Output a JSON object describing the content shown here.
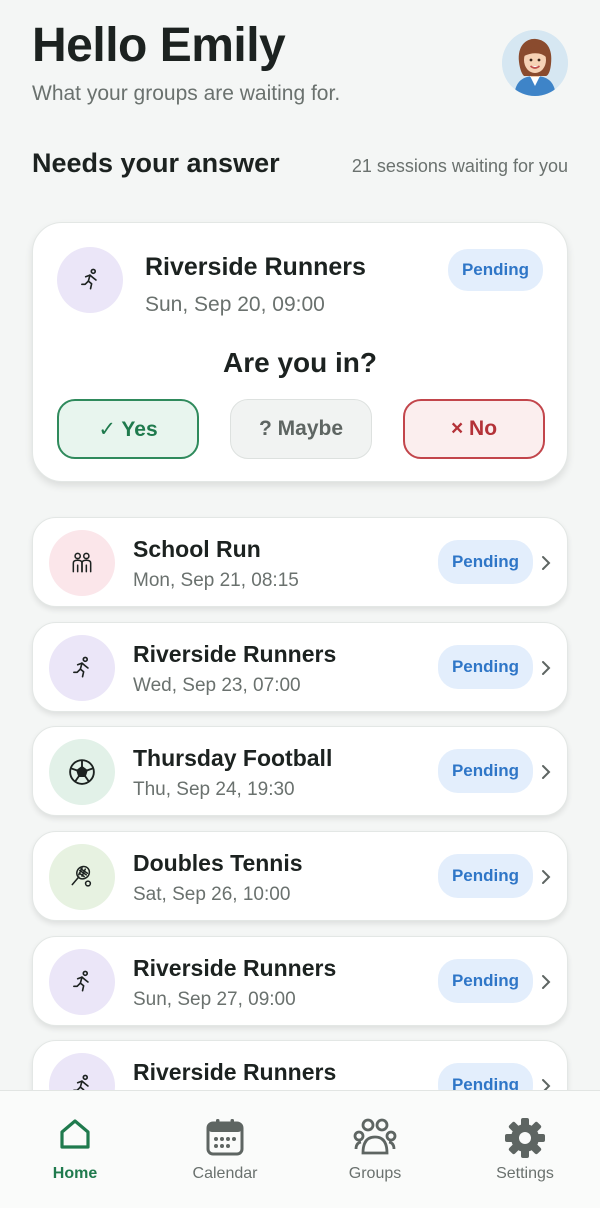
{
  "header": {
    "greeting": "Hello Emily",
    "subtitle": "What your groups are waiting for.",
    "avatar_icon": "user-avatar"
  },
  "section": {
    "title": "Needs your answer",
    "count": "21 sessions waiting for you"
  },
  "hero": {
    "title": "Riverside Runners",
    "date": "Sun, Sep 20, 09:00",
    "status": "Pending",
    "icon": "runner-icon",
    "question": "Are you in?",
    "yes_label": "✓ Yes",
    "maybe_label": "? Maybe",
    "no_label": "× No"
  },
  "sessions": [
    {
      "title": "School Run",
      "date": "Mon, Sep 21, 08:15",
      "status": "Pending",
      "icon": "people-icon"
    },
    {
      "title": "Riverside Runners",
      "date": "Wed, Sep 23, 07:00",
      "status": "Pending",
      "icon": "runner-icon"
    },
    {
      "title": "Thursday Football",
      "date": "Thu, Sep 24, 19:30",
      "status": "Pending",
      "icon": "football-icon"
    },
    {
      "title": "Doubles Tennis",
      "date": "Sat, Sep 26, 10:00",
      "status": "Pending",
      "icon": "tennis-icon"
    },
    {
      "title": "Riverside Runners",
      "date": "Sun, Sep 27, 09:00",
      "status": "Pending",
      "icon": "runner-icon"
    },
    {
      "title": "Riverside Runners",
      "date": "",
      "status": "Pending",
      "icon": "runner-icon"
    }
  ],
  "nav": {
    "home": "Home",
    "calendar": "Calendar",
    "groups": "Groups",
    "settings": "Settings",
    "active": "Home"
  },
  "colors": {
    "accent_green": "#1f7a4d",
    "pending_blue": "#2f76c7",
    "no_red": "#b43238"
  }
}
